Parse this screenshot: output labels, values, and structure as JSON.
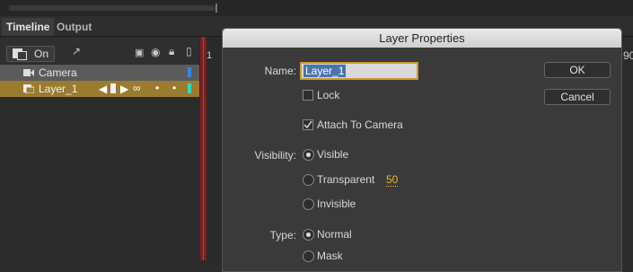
{
  "tabs": [
    {
      "label": "Timeline",
      "active": true
    },
    {
      "label": "Output",
      "active": false
    }
  ],
  "toolbar": {
    "on_label": "On"
  },
  "layers": [
    {
      "name": "Camera",
      "color": "#2f8be0"
    },
    {
      "name": "Layer_1",
      "color": "#2fd8c8"
    }
  ],
  "timeline": {
    "frame_start": "1",
    "frame_end": "90"
  },
  "dialog": {
    "title": "Layer Properties",
    "name_label": "Name:",
    "name_value": "Layer_1",
    "lock_label": "Lock",
    "lock_checked": false,
    "attach_label": "Attach To Camera",
    "attach_checked": true,
    "visibility_label": "Visibility:",
    "visibility_options": [
      "Visible",
      "Transparent",
      "Invisible"
    ],
    "visibility_selected": "Visible",
    "transparent_value": "50",
    "type_label": "Type:",
    "type_options": [
      "Normal",
      "Mask"
    ],
    "type_selected": "Normal",
    "ok_label": "OK",
    "cancel_label": "Cancel"
  },
  "colors": {
    "accent": "#c99a2e",
    "selected_row": "#9b7b2d",
    "playhead": "#dd3333"
  }
}
